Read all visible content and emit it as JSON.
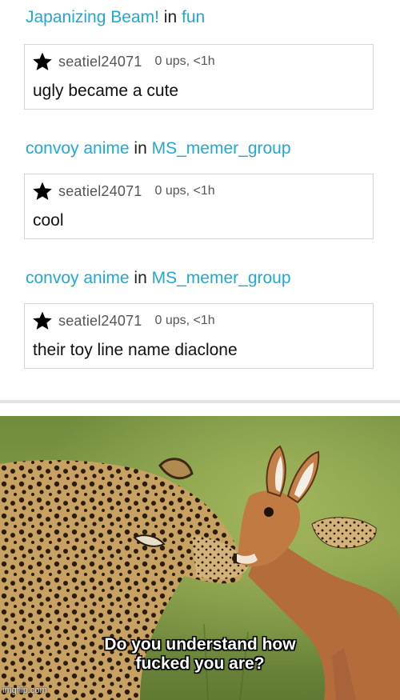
{
  "comments": [
    {
      "post": "Japanizing Beam!",
      "in": "in",
      "stream": "fun",
      "user": "seatiel24071",
      "meta": "0 ups, <1h",
      "text": "ugly became a cute"
    },
    {
      "post": "convoy anime",
      "in": "in",
      "stream": "MS_memer_group",
      "user": "seatiel24071",
      "meta": "0 ups, <1h",
      "text": "cool"
    },
    {
      "post": "convoy anime",
      "in": "in",
      "stream": "MS_memer_group",
      "user": "seatiel24071",
      "meta": "0 ups, <1h",
      "text": "their toy line name diaclone"
    }
  ],
  "meme": {
    "caption_line1": "Do you understand how",
    "caption_line2": "fucked you are?",
    "watermark": "imgflip.com"
  },
  "colors": {
    "link": "#1fa8d6",
    "border": "#d4d4d4"
  },
  "icons": {
    "star": "star-icon"
  }
}
